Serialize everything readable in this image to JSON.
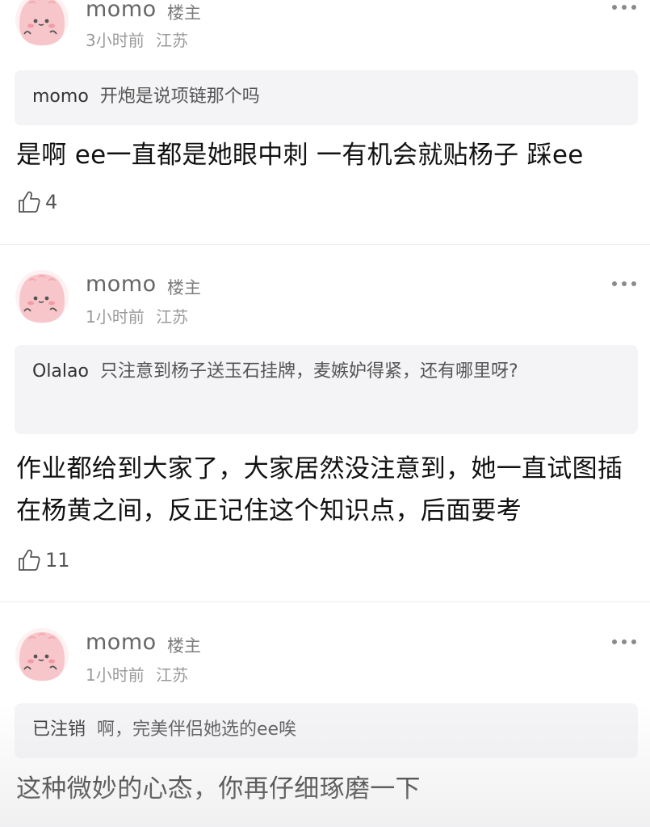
{
  "comments": [
    {
      "username": "momo",
      "badge": "楼主",
      "time": "3小时前",
      "location": "江苏",
      "quote_author": "momo",
      "quote_text": "开炮是说项链那个吗",
      "text": "是啊 ee一直都是她眼中刺 一有机会就贴杨子 踩ee",
      "likes": "4"
    },
    {
      "username": "momo",
      "badge": "楼主",
      "time": "1小时前",
      "location": "江苏",
      "quote_author": "Olalao",
      "quote_text": "只注意到杨子送玉石挂牌，麦嫉妒得紧，还有哪里呀?",
      "text": "作业都给到大家了，大家居然没注意到，她一直试图插在杨黄之间，反正记住这个知识点，后面要考",
      "likes": "11"
    },
    {
      "username": "momo",
      "badge": "楼主",
      "time": "1小时前",
      "location": "江苏",
      "quote_author": "已注销",
      "quote_text": "啊，完美伴侣她选的ee唉",
      "text": "这种微妙的心态，你再仔细琢磨一下"
    }
  ],
  "icons": {
    "avatar": "pink-blob-avatar-icon",
    "more": "more-dots-icon",
    "like": "thumbs-up-icon"
  },
  "colors": {
    "avatar_pink": "#f7c5c9",
    "quote_bg": "#f4f4f6",
    "meta": "#9a9a9a"
  }
}
